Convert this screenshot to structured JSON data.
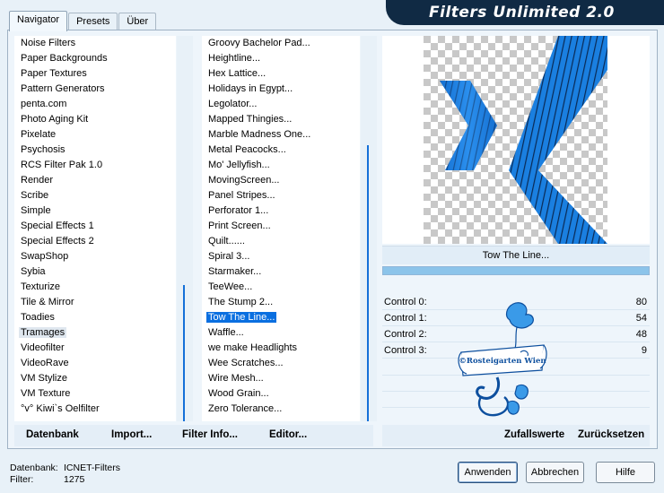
{
  "tabs": [
    {
      "label": "Navigator",
      "active": true
    },
    {
      "label": "Presets",
      "active": false
    },
    {
      "label": "Über",
      "active": false
    }
  ],
  "header": {
    "title": "Filters Unlimited 2.0"
  },
  "categories": [
    "Noise Filters",
    "Paper Backgrounds",
    "Paper Textures",
    "Pattern Generators",
    "penta.com",
    "Photo Aging Kit",
    "Pixelate",
    "Psychosis",
    "RCS Filter Pak 1.0",
    "Render",
    "Scribe",
    "Simple",
    "Special Effects 1",
    "Special Effects 2",
    "SwapShop",
    "Sybia",
    "Texturize",
    "Tile & Mirror",
    "Toadies",
    "Tramages",
    "Videofilter",
    "VideoRave",
    "VM Stylize",
    "VM Texture",
    "°v° Kiwi`s Oelfilter"
  ],
  "selected_category": "Tramages",
  "filters": [
    "Groovy Bachelor Pad...",
    "Heightline...",
    "Hex Lattice...",
    "Holidays in Egypt...",
    "Legolator...",
    "Mapped Thingies...",
    "Marble Madness One...",
    "Metal Peacocks...",
    "Mo' Jellyfish...",
    "MovingScreen...",
    "Panel Stripes...",
    "Perforator 1...",
    "Print Screen...",
    "Quilt......",
    "Spiral 3...",
    "Starmaker...",
    "TeeWee...",
    "The Stump 2...",
    "Tow The Line...",
    "Waffle...",
    "we make Headlights",
    "Wee Scratches...",
    "Wire Mesh...",
    "Wood Grain...",
    "Zero Tolerance..."
  ],
  "selected_filter": "Tow The Line...",
  "preview": {
    "filter_name": "Tow The Line...",
    "progress": 1.0,
    "accent_color": "#1a7fe0"
  },
  "controls": [
    {
      "label": "Control 0:",
      "value": "80"
    },
    {
      "label": "Control 1:",
      "value": "54"
    },
    {
      "label": "Control 2:",
      "value": "48"
    },
    {
      "label": "Control 3:",
      "value": "9"
    }
  ],
  "watermark": {
    "text": "©Rosteigarten Wien"
  },
  "toolbar": {
    "datenbank": "Datenbank",
    "import": "Import...",
    "filter_info": "Filter Info...",
    "editor": "Editor...",
    "zufallswerte": "Zufallswerte",
    "zuruecksetzen": "Zurücksetzen"
  },
  "status": {
    "db_key": "Datenbank:",
    "db_value": "ICNET-Filters",
    "filter_key": "Filter:",
    "filter_value": "1275"
  },
  "buttons": {
    "apply": "Anwenden",
    "cancel": "Abbrechen",
    "help": "Hilfe"
  }
}
